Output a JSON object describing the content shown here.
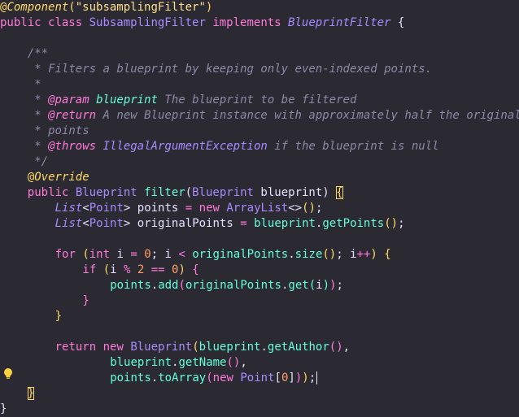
{
  "editor": {
    "language": "java",
    "lines": [
      {
        "indent": 0,
        "tokens": [
          {
            "t": "@",
            "c": "annot"
          },
          {
            "t": "Component",
            "c": "annot-italic"
          },
          {
            "t": "(",
            "c": "paren"
          },
          {
            "t": "\"subsamplingFilter\"",
            "c": "string"
          },
          {
            "t": ")",
            "c": "paren"
          }
        ]
      },
      {
        "indent": 0,
        "tokens": [
          {
            "t": "public ",
            "c": "keyword"
          },
          {
            "t": "class ",
            "c": "keyword"
          },
          {
            "t": "SubsamplingFilter ",
            "c": "class"
          },
          {
            "t": "implements ",
            "c": "keyword"
          },
          {
            "t": "BlueprintFilter ",
            "c": "type"
          },
          {
            "t": "{",
            "c": "punct"
          }
        ]
      },
      {
        "indent": 0,
        "tokens": []
      },
      {
        "indent": 4,
        "tokens": [
          {
            "t": "/**",
            "c": "comment"
          }
        ]
      },
      {
        "indent": 4,
        "tokens": [
          {
            "t": " * Filters a blueprint by keeping only even-indexed points.",
            "c": "comment"
          }
        ]
      },
      {
        "indent": 4,
        "tokens": [
          {
            "t": " *",
            "c": "comment"
          }
        ]
      },
      {
        "indent": 4,
        "tokens": [
          {
            "t": " * ",
            "c": "comment"
          },
          {
            "t": "@param ",
            "c": "doctag"
          },
          {
            "t": "blueprint",
            "c": "param"
          },
          {
            "t": " The blueprint to be filtered",
            "c": "comment"
          }
        ]
      },
      {
        "indent": 4,
        "tokens": [
          {
            "t": " * ",
            "c": "comment"
          },
          {
            "t": "@return",
            "c": "doctag"
          },
          {
            "t": " A new Blueprint instance with approximately half the original",
            "c": "comment"
          }
        ]
      },
      {
        "indent": 4,
        "tokens": [
          {
            "t": " * points",
            "c": "comment"
          }
        ]
      },
      {
        "indent": 4,
        "tokens": [
          {
            "t": " * ",
            "c": "comment"
          },
          {
            "t": "@throws ",
            "c": "doctag"
          },
          {
            "t": "IllegalArgumentException",
            "c": "type"
          },
          {
            "t": " if the blueprint is null",
            "c": "comment"
          }
        ]
      },
      {
        "indent": 4,
        "tokens": [
          {
            "t": " */",
            "c": "comment"
          }
        ]
      },
      {
        "indent": 4,
        "tokens": [
          {
            "t": "@",
            "c": "annot"
          },
          {
            "t": "Override",
            "c": "annot-italic"
          }
        ]
      },
      {
        "indent": 4,
        "tokens": [
          {
            "t": "public ",
            "c": "keyword"
          },
          {
            "t": "Blueprint ",
            "c": "class"
          },
          {
            "t": "filter",
            "c": "method"
          },
          {
            "t": "(",
            "c": "punct"
          },
          {
            "t": "Blueprint ",
            "c": "class"
          },
          {
            "t": "blueprint",
            "c": "var"
          },
          {
            "t": ") ",
            "c": "punct"
          },
          {
            "t": "{",
            "c": "paren",
            "box": true
          }
        ]
      },
      {
        "indent": 8,
        "tokens": [
          {
            "t": "List",
            "c": "type"
          },
          {
            "t": "<",
            "c": "punct"
          },
          {
            "t": "Point",
            "c": "class"
          },
          {
            "t": "> ",
            "c": "punct"
          },
          {
            "t": "points ",
            "c": "var"
          },
          {
            "t": "= ",
            "c": "op"
          },
          {
            "t": "new ",
            "c": "keyword"
          },
          {
            "t": "ArrayList",
            "c": "class"
          },
          {
            "t": "<>",
            "c": "punct"
          },
          {
            "t": "()",
            "c": "paren"
          },
          {
            "t": ";",
            "c": "punct"
          }
        ]
      },
      {
        "indent": 8,
        "tokens": [
          {
            "t": "List",
            "c": "type"
          },
          {
            "t": "<",
            "c": "punct"
          },
          {
            "t": "Point",
            "c": "class"
          },
          {
            "t": "> ",
            "c": "punct"
          },
          {
            "t": "originalPoints ",
            "c": "var"
          },
          {
            "t": "= ",
            "c": "op"
          },
          {
            "t": "blueprint",
            "c": "method"
          },
          {
            "t": ".",
            "c": "punct"
          },
          {
            "t": "getPoints",
            "c": "method"
          },
          {
            "t": "()",
            "c": "paren"
          },
          {
            "t": ";",
            "c": "punct"
          }
        ]
      },
      {
        "indent": 0,
        "tokens": []
      },
      {
        "indent": 8,
        "tokens": [
          {
            "t": "for ",
            "c": "keyword"
          },
          {
            "t": "(",
            "c": "paren"
          },
          {
            "t": "int ",
            "c": "keyword"
          },
          {
            "t": "i ",
            "c": "var"
          },
          {
            "t": "= ",
            "c": "op"
          },
          {
            "t": "0",
            "c": "number"
          },
          {
            "t": "; ",
            "c": "punct"
          },
          {
            "t": "i ",
            "c": "var"
          },
          {
            "t": "< ",
            "c": "op"
          },
          {
            "t": "originalPoints",
            "c": "method"
          },
          {
            "t": ".",
            "c": "punct"
          },
          {
            "t": "size",
            "c": "method"
          },
          {
            "t": "()",
            "c": "paren"
          },
          {
            "t": "; ",
            "c": "punct"
          },
          {
            "t": "i",
            "c": "var"
          },
          {
            "t": "++",
            "c": "op"
          },
          {
            "t": ") ",
            "c": "paren"
          },
          {
            "t": "{",
            "c": "paren"
          }
        ]
      },
      {
        "indent": 12,
        "tokens": [
          {
            "t": "if ",
            "c": "keyword"
          },
          {
            "t": "(",
            "c": "paren"
          },
          {
            "t": "i ",
            "c": "var"
          },
          {
            "t": "% ",
            "c": "op"
          },
          {
            "t": "2 ",
            "c": "number"
          },
          {
            "t": "== ",
            "c": "op"
          },
          {
            "t": "0",
            "c": "number"
          },
          {
            "t": ") ",
            "c": "paren"
          },
          {
            "t": "{",
            "c": "keyword"
          }
        ]
      },
      {
        "indent": 16,
        "tokens": [
          {
            "t": "points",
            "c": "method"
          },
          {
            "t": ".",
            "c": "punct"
          },
          {
            "t": "add",
            "c": "method"
          },
          {
            "t": "(",
            "c": "keyword"
          },
          {
            "t": "originalPoints",
            "c": "method"
          },
          {
            "t": ".",
            "c": "punct"
          },
          {
            "t": "get",
            "c": "method"
          },
          {
            "t": "(",
            "c": "method"
          },
          {
            "t": "i",
            "c": "var"
          },
          {
            "t": ")",
            "c": "method"
          },
          {
            "t": ")",
            "c": "keyword"
          },
          {
            "t": ";",
            "c": "punct"
          }
        ]
      },
      {
        "indent": 12,
        "tokens": [
          {
            "t": "}",
            "c": "keyword"
          }
        ]
      },
      {
        "indent": 8,
        "tokens": [
          {
            "t": "}",
            "c": "paren"
          }
        ]
      },
      {
        "indent": 0,
        "tokens": []
      },
      {
        "indent": 8,
        "tokens": [
          {
            "t": "return ",
            "c": "keyword"
          },
          {
            "t": "new ",
            "c": "keyword"
          },
          {
            "t": "Blueprint",
            "c": "class"
          },
          {
            "t": "(",
            "c": "paren"
          },
          {
            "t": "blueprint",
            "c": "method"
          },
          {
            "t": ".",
            "c": "punct"
          },
          {
            "t": "getAuthor",
            "c": "method"
          },
          {
            "t": "()",
            "c": "keyword"
          },
          {
            "t": ",",
            "c": "punct"
          }
        ]
      },
      {
        "indent": 16,
        "tokens": [
          {
            "t": "blueprint",
            "c": "method"
          },
          {
            "t": ".",
            "c": "punct"
          },
          {
            "t": "getName",
            "c": "method"
          },
          {
            "t": "()",
            "c": "keyword"
          },
          {
            "t": ",",
            "c": "punct"
          }
        ]
      },
      {
        "indent": 16,
        "caret": true,
        "tokens": [
          {
            "t": "points",
            "c": "method"
          },
          {
            "t": ".",
            "c": "punct"
          },
          {
            "t": "toArray",
            "c": "method"
          },
          {
            "t": "(",
            "c": "keyword"
          },
          {
            "t": "new ",
            "c": "keyword"
          },
          {
            "t": "Point",
            "c": "class"
          },
          {
            "t": "[",
            "c": "punct"
          },
          {
            "t": "0",
            "c": "number"
          },
          {
            "t": "]",
            "c": "punct"
          },
          {
            "t": ")",
            "c": "keyword"
          },
          {
            "t": ")",
            "c": "paren"
          },
          {
            "t": ";",
            "c": "punct"
          }
        ]
      },
      {
        "indent": 4,
        "tokens": [
          {
            "t": "}",
            "c": "paren",
            "box": true
          }
        ]
      },
      {
        "indent": 0,
        "tokens": [
          {
            "t": "}",
            "c": "punct"
          }
        ]
      }
    ]
  },
  "icons": {
    "lightbulb": "lightbulb-icon",
    "fold_marker": "fold-marker-icon"
  },
  "colors": {
    "background": "#2b2a33",
    "keyword": "#ff7ad9",
    "type": "#a98bff",
    "string": "#ffe08a",
    "method": "#64ffda",
    "comment": "#8c89a6",
    "number": "#ff9e64",
    "bulb": "#ffd23f"
  }
}
